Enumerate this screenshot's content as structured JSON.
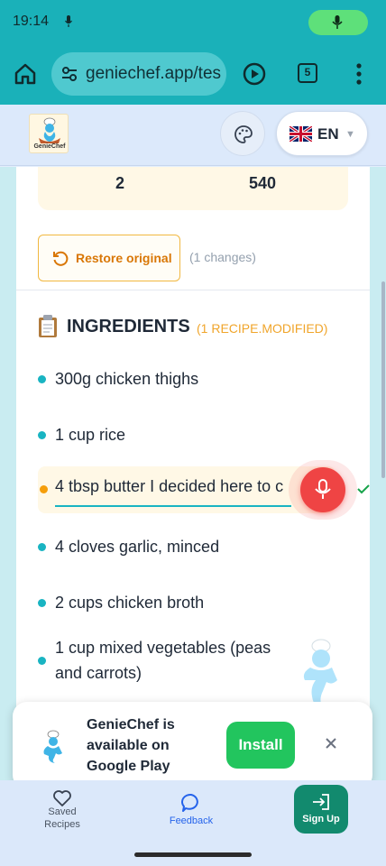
{
  "status_bar": {
    "time": "19:14"
  },
  "browser": {
    "url": "geniechef.app/tes",
    "tab_count": "5"
  },
  "header": {
    "logo_text": "GenieChef",
    "language": "EN",
    "language_caret": "▼"
  },
  "stats": {
    "value_1": "2",
    "value_2": "540"
  },
  "restore": {
    "label": "Restore original",
    "changes": "(1 changes)"
  },
  "ingredients": {
    "title": "INGREDIENTS",
    "modified_note": "(1 RECIPE.MODIFIED)",
    "items": [
      {
        "text": "300g chicken thighs"
      },
      {
        "text": "1 cup rice"
      },
      {
        "text": "4 cloves garlic, minced"
      },
      {
        "text": "2 cups chicken broth"
      },
      {
        "text": "1 cup mixed vegetables (peas and carrots)"
      }
    ],
    "editing_value": "4 tbsp butter I decided here to c"
  },
  "install_banner": {
    "text": "GenieChef is available on Google Play",
    "install_label": "Install",
    "close_glyph": "×"
  },
  "bottom_nav": {
    "saved_label": "Saved Recipes",
    "feedback_label": "Feedback",
    "signup_label": "Sign Up"
  },
  "colors": {
    "status_bar_bg": "#1ab1b9",
    "accent_teal": "#19b4c2",
    "warning_orange": "#f59e0b",
    "mic_red": "#ef4444",
    "install_green": "#22c55e",
    "signup_green": "#128a6e"
  }
}
